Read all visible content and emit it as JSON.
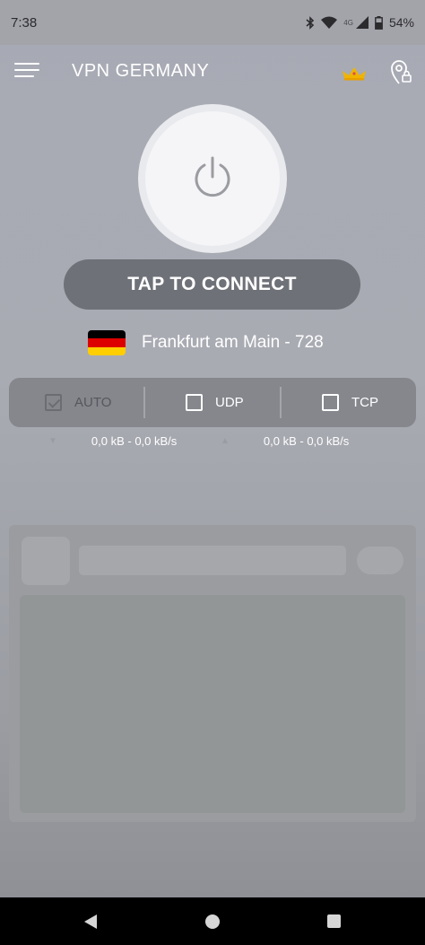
{
  "status_bar": {
    "time": "7:38",
    "network": "4G",
    "battery": "54%",
    "icons": [
      "bluetooth-icon",
      "wifi-icon",
      "signal-icon",
      "battery-icon"
    ]
  },
  "app_bar": {
    "title": "VPN GERMANY",
    "icons": [
      "menu-icon",
      "crown-icon",
      "location-lock-icon"
    ]
  },
  "main": {
    "power_icon": "power-icon",
    "connect_label": "TAP TO CONNECT",
    "server": {
      "flag_colors": [
        "#000000",
        "#dd0000",
        "#ffce00"
      ],
      "name": "Frankfurt am Main - 728"
    },
    "protocols": [
      {
        "label": "AUTO",
        "checked": true,
        "disabled": true
      },
      {
        "label": "UDP",
        "checked": false,
        "disabled": false
      },
      {
        "label": "TCP",
        "checked": false,
        "disabled": false
      }
    ],
    "stats": [
      {
        "text": "0,0 kB - 0,0 kB/s"
      },
      {
        "text": "0,0 kB - 0,0 kB/s"
      }
    ]
  },
  "colors": {
    "connect_button": "#6f7178",
    "accent_crown": "#f0b400"
  },
  "nav_bar": {
    "icons": [
      "back-icon",
      "home-icon",
      "recents-icon"
    ]
  }
}
